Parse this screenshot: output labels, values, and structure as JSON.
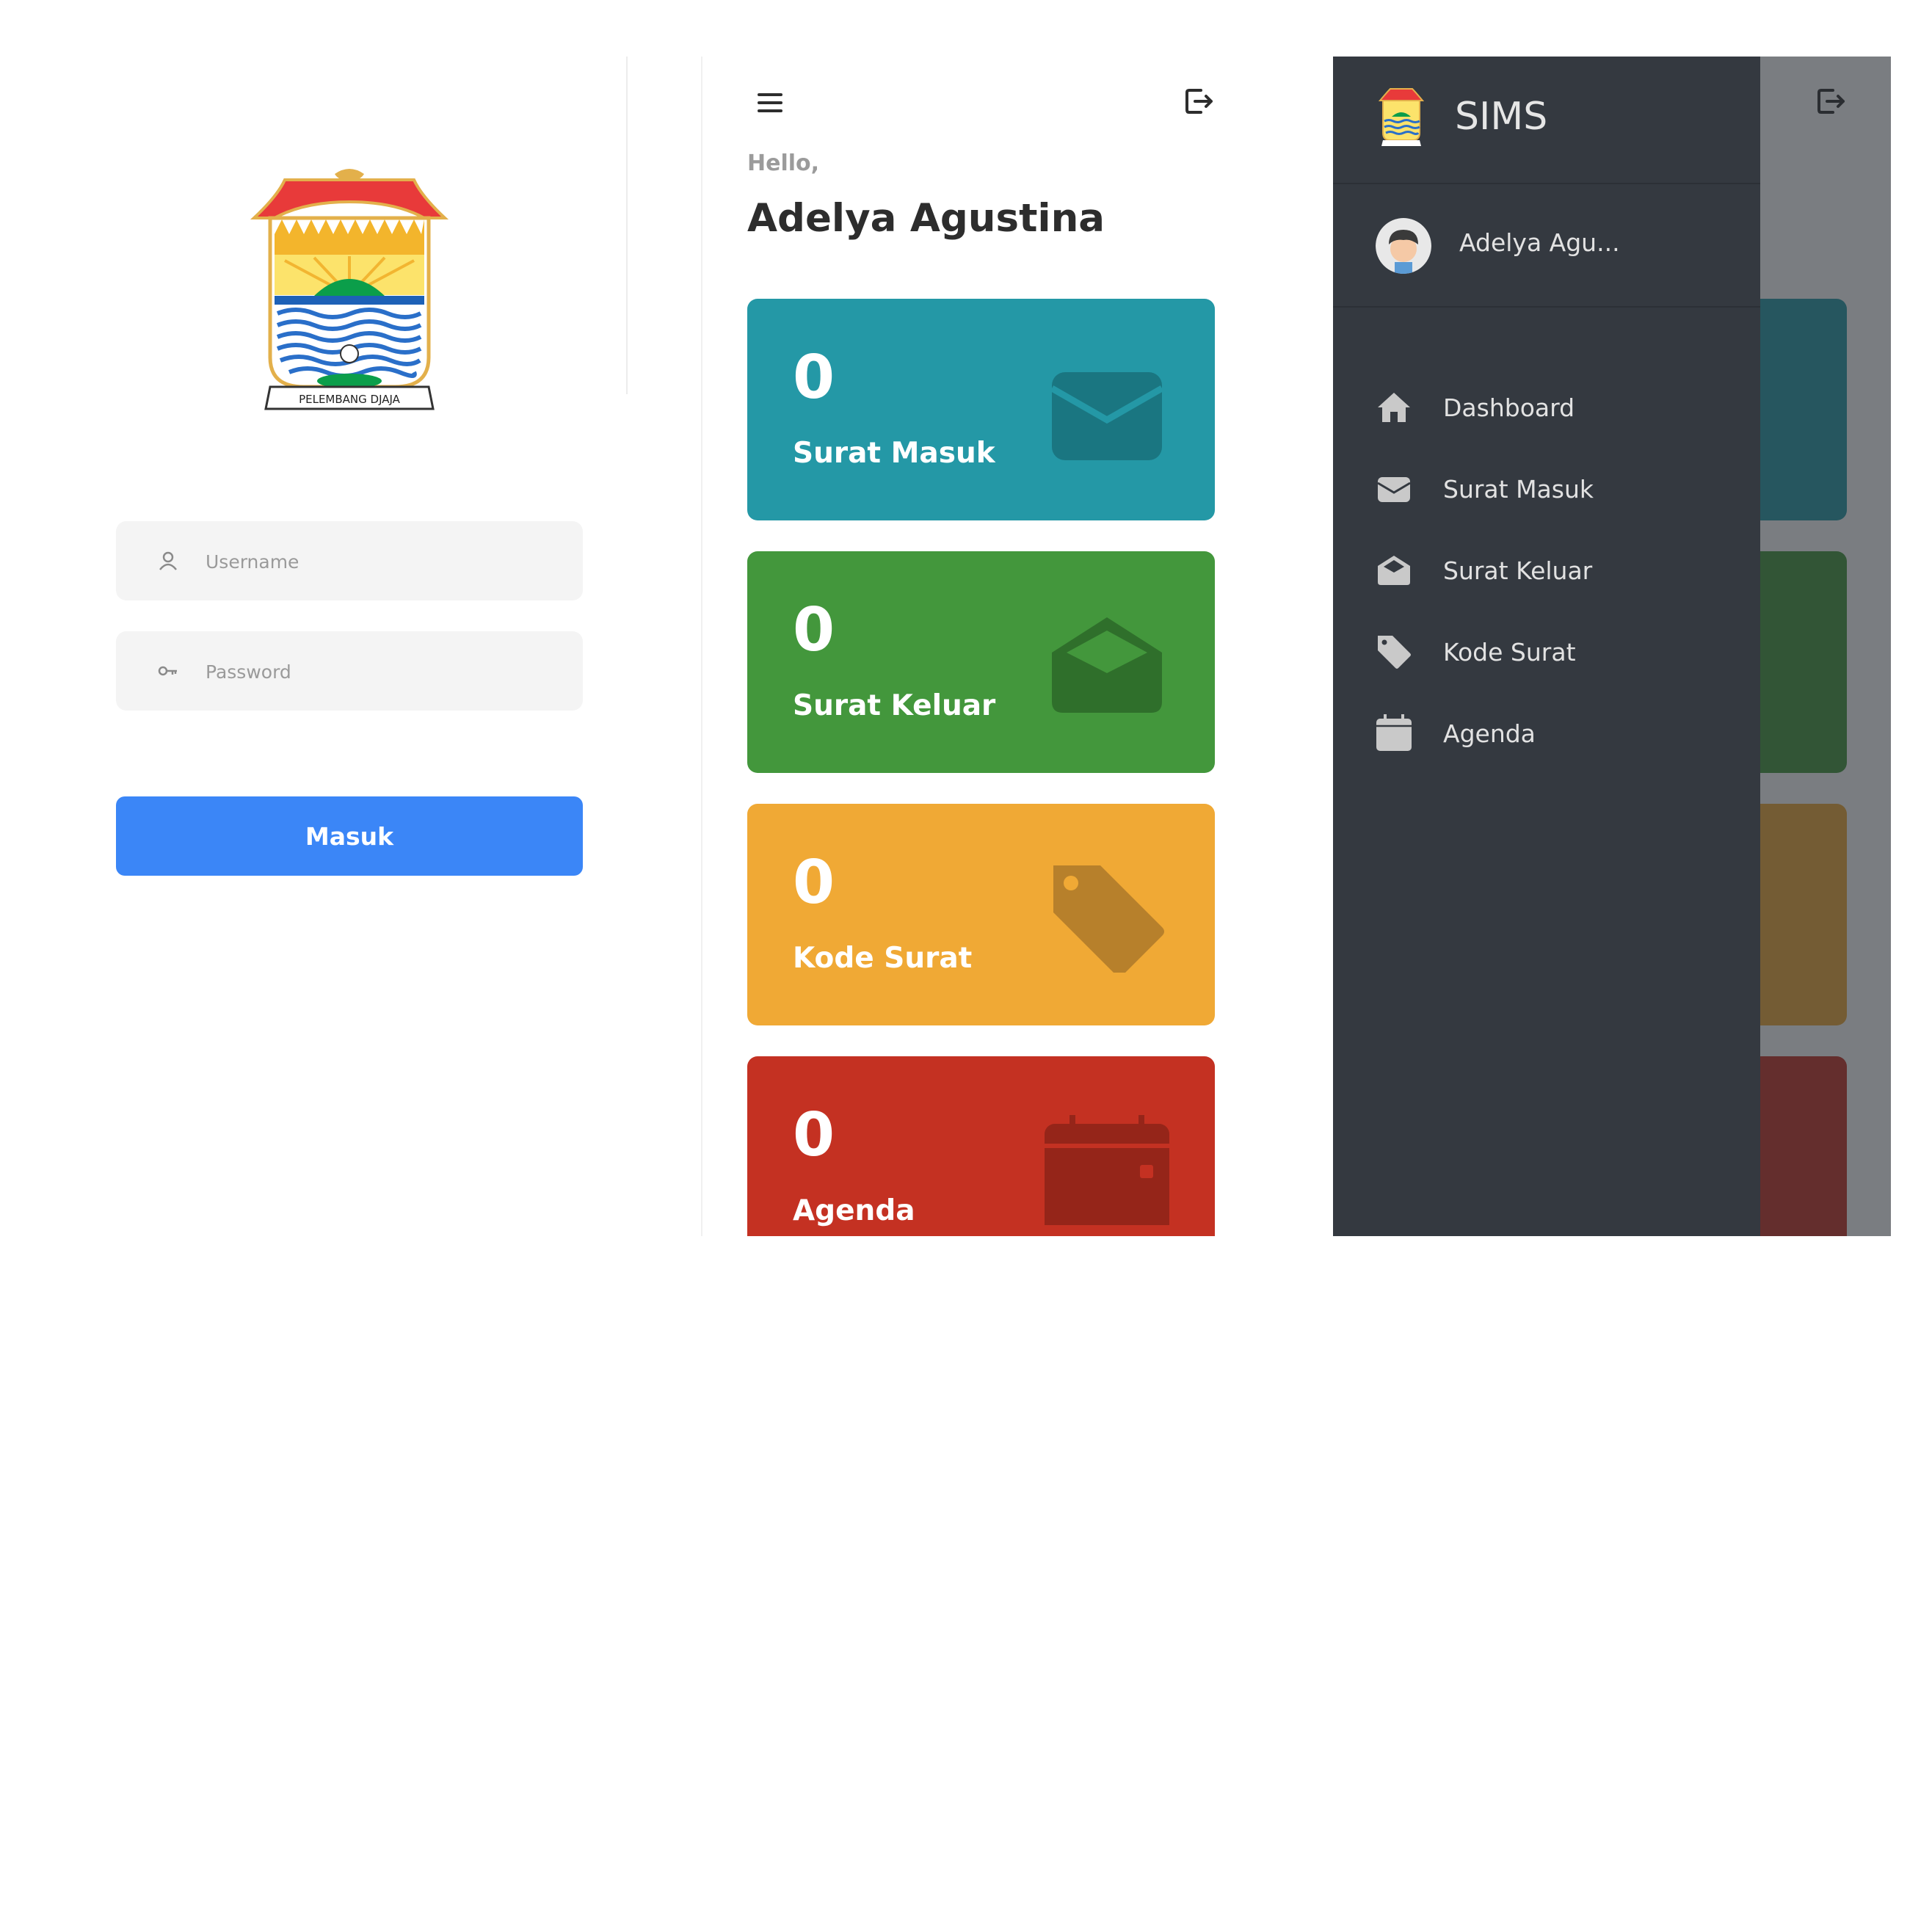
{
  "login": {
    "username_placeholder": "Username",
    "password_placeholder": "Password",
    "submit_label": "Masuk",
    "crest_motto": "PELEMBANG DJAJA",
    "button_color": "#3b86f7"
  },
  "dashboard": {
    "greeting": "Hello,",
    "user_name": "Adelya Agustina",
    "header_icons": [
      "menu-icon",
      "logout-icon"
    ],
    "cards": [
      {
        "count": "0",
        "label": "Surat Masuk",
        "color": "#2498a6",
        "icon": "envelope-icon"
      },
      {
        "count": "0",
        "label": "Surat Keluar",
        "color": "#43973c",
        "icon": "envelope-open-icon"
      },
      {
        "count": "0",
        "label": "Kode Surat",
        "color": "#f0a935",
        "icon": "tag-icon"
      },
      {
        "count": "0",
        "label": "Agenda",
        "color": "#c43122",
        "icon": "calendar-icon"
      }
    ]
  },
  "sidebar": {
    "brand": "SIMS",
    "user_name": "Adelya Agu...",
    "items": [
      {
        "label": "Dashboard",
        "icon": "home-icon"
      },
      {
        "label": "Surat Masuk",
        "icon": "envelope-icon"
      },
      {
        "label": "Surat Keluar",
        "icon": "envelope-open-icon"
      },
      {
        "label": "Kode Surat",
        "icon": "tag-icon"
      },
      {
        "label": "Agenda",
        "icon": "calendar-icon"
      }
    ],
    "panel_color": "#343940"
  }
}
